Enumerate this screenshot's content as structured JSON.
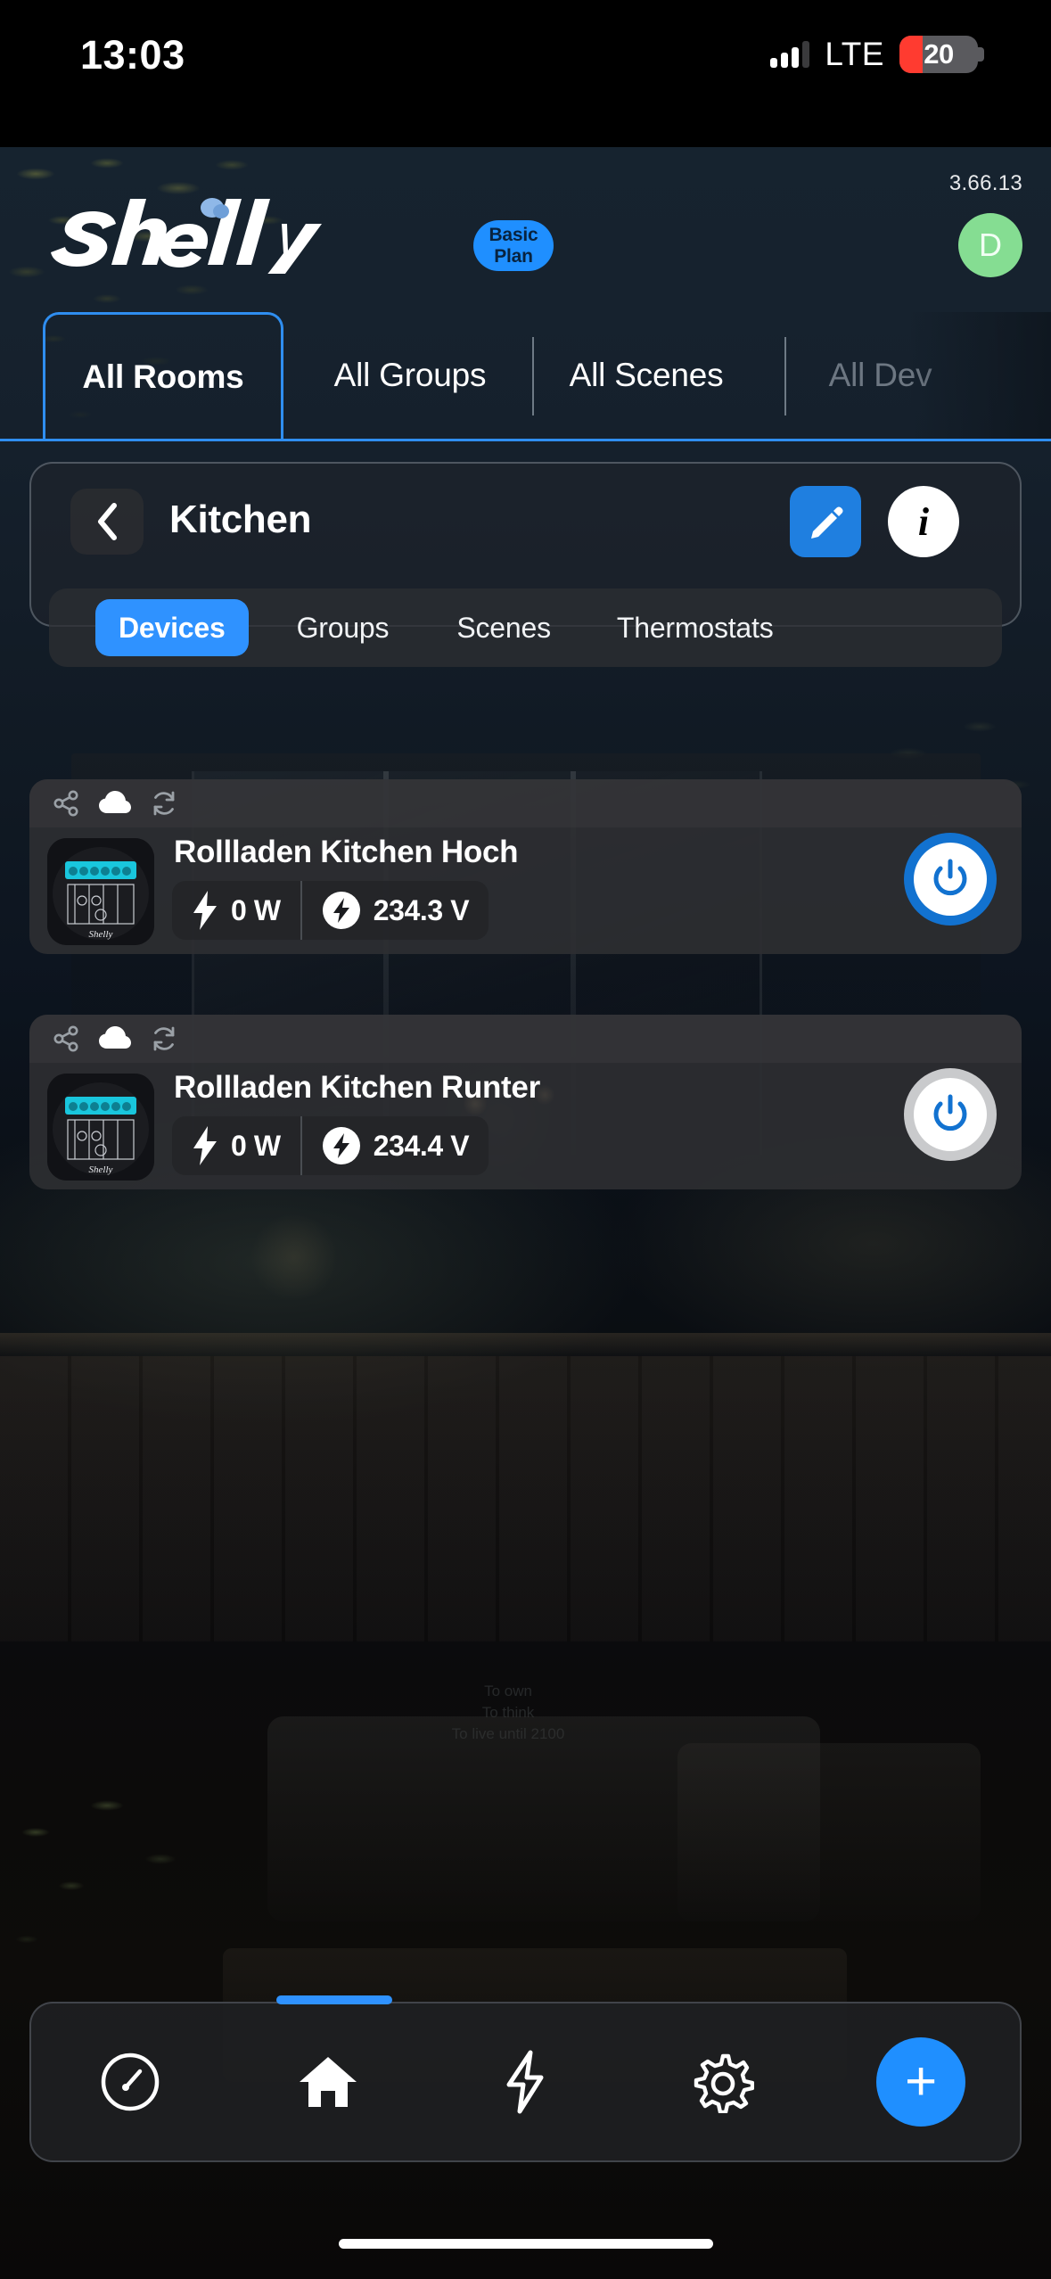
{
  "status_bar": {
    "time": "13:03",
    "network": "LTE",
    "battery_percent": "20",
    "signal_bars_filled": 3,
    "signal_bars_total": 4,
    "battery_low_color": "#ff3b30"
  },
  "header": {
    "brand": "Shelly",
    "version": "3.66.13",
    "plan_label": "Basic Plan",
    "avatar_initial": "D",
    "plan_color": "#1f8fff",
    "avatar_color": "#85dd92"
  },
  "tabs": {
    "active_index": 0,
    "items": [
      {
        "label": "All Rooms"
      },
      {
        "label": "All Groups"
      },
      {
        "label": "All Scenes"
      },
      {
        "label": "All Dev"
      }
    ],
    "accent_color": "#2f8ef0"
  },
  "room": {
    "title": "Kitchen",
    "back_label": "Back",
    "edit_label": "Edit",
    "info_label": "i",
    "edit_color": "#1f7fe0"
  },
  "subtabs": {
    "active_index": 0,
    "items": [
      {
        "label": "Devices"
      },
      {
        "label": "Groups"
      },
      {
        "label": "Scenes"
      },
      {
        "label": "Thermostats"
      }
    ],
    "active_color": "#2f92ff"
  },
  "devices": [
    {
      "name": "Rollladen Kitchen Hoch",
      "power": "0 W",
      "voltage": "234.3 V",
      "toggle_state": "on",
      "status_icons": [
        "share-icon",
        "cloud-icon",
        "refresh-icon"
      ],
      "thumbnail_label": "Shelly"
    },
    {
      "name": "Rollladen Kitchen Runter",
      "power": "0 W",
      "voltage": "234.4 V",
      "toggle_state": "off",
      "status_icons": [
        "share-icon",
        "cloud-icon",
        "refresh-icon"
      ],
      "thumbnail_label": "Shelly"
    }
  ],
  "bottom_nav": {
    "items": [
      {
        "icon": "dashboard-gauge-icon"
      },
      {
        "icon": "home-icon"
      },
      {
        "icon": "lightning-icon"
      },
      {
        "icon": "gear-icon"
      }
    ],
    "add_label": "+",
    "add_color": "#1f8fff",
    "active_index": 1
  },
  "background": {
    "wall_text_line1": "To own",
    "wall_text_line2": "To think",
    "wall_text_line3": "To live until 2100"
  }
}
